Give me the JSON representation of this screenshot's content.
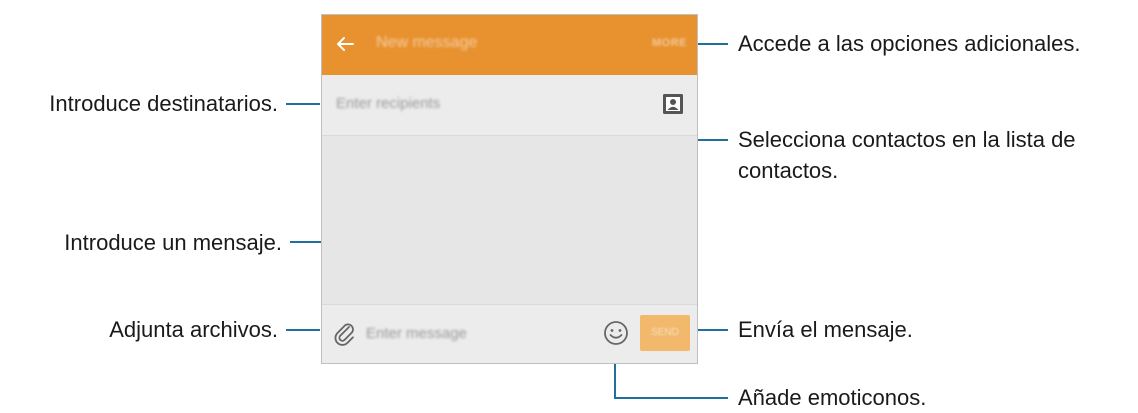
{
  "screen": {
    "appbar": {
      "title": "New message",
      "more_label": "MORE",
      "color": "#e8912f"
    },
    "recipient": {
      "placeholder": "Enter recipients"
    },
    "compose": {
      "placeholder": "Enter message",
      "send_label": "SEND",
      "send_color": "#f2b96d"
    },
    "icons": {
      "back": "arrow-left-icon",
      "contacts": "contact-card-icon",
      "attach": "paperclip-icon",
      "emoji": "smiley-face-icon"
    }
  },
  "callouts": {
    "more_options": "Accede a las opciones adicionales.",
    "recipients": "Introduce destinatarios.",
    "contacts_line1": "Selecciona contactos en la lista de",
    "contacts_line2": "contactos.",
    "message": "Introduce un mensaje.",
    "attach": "Adjunta archivos.",
    "send": "Envía el mensaje.",
    "emoticons": "Añade emoticonos."
  }
}
